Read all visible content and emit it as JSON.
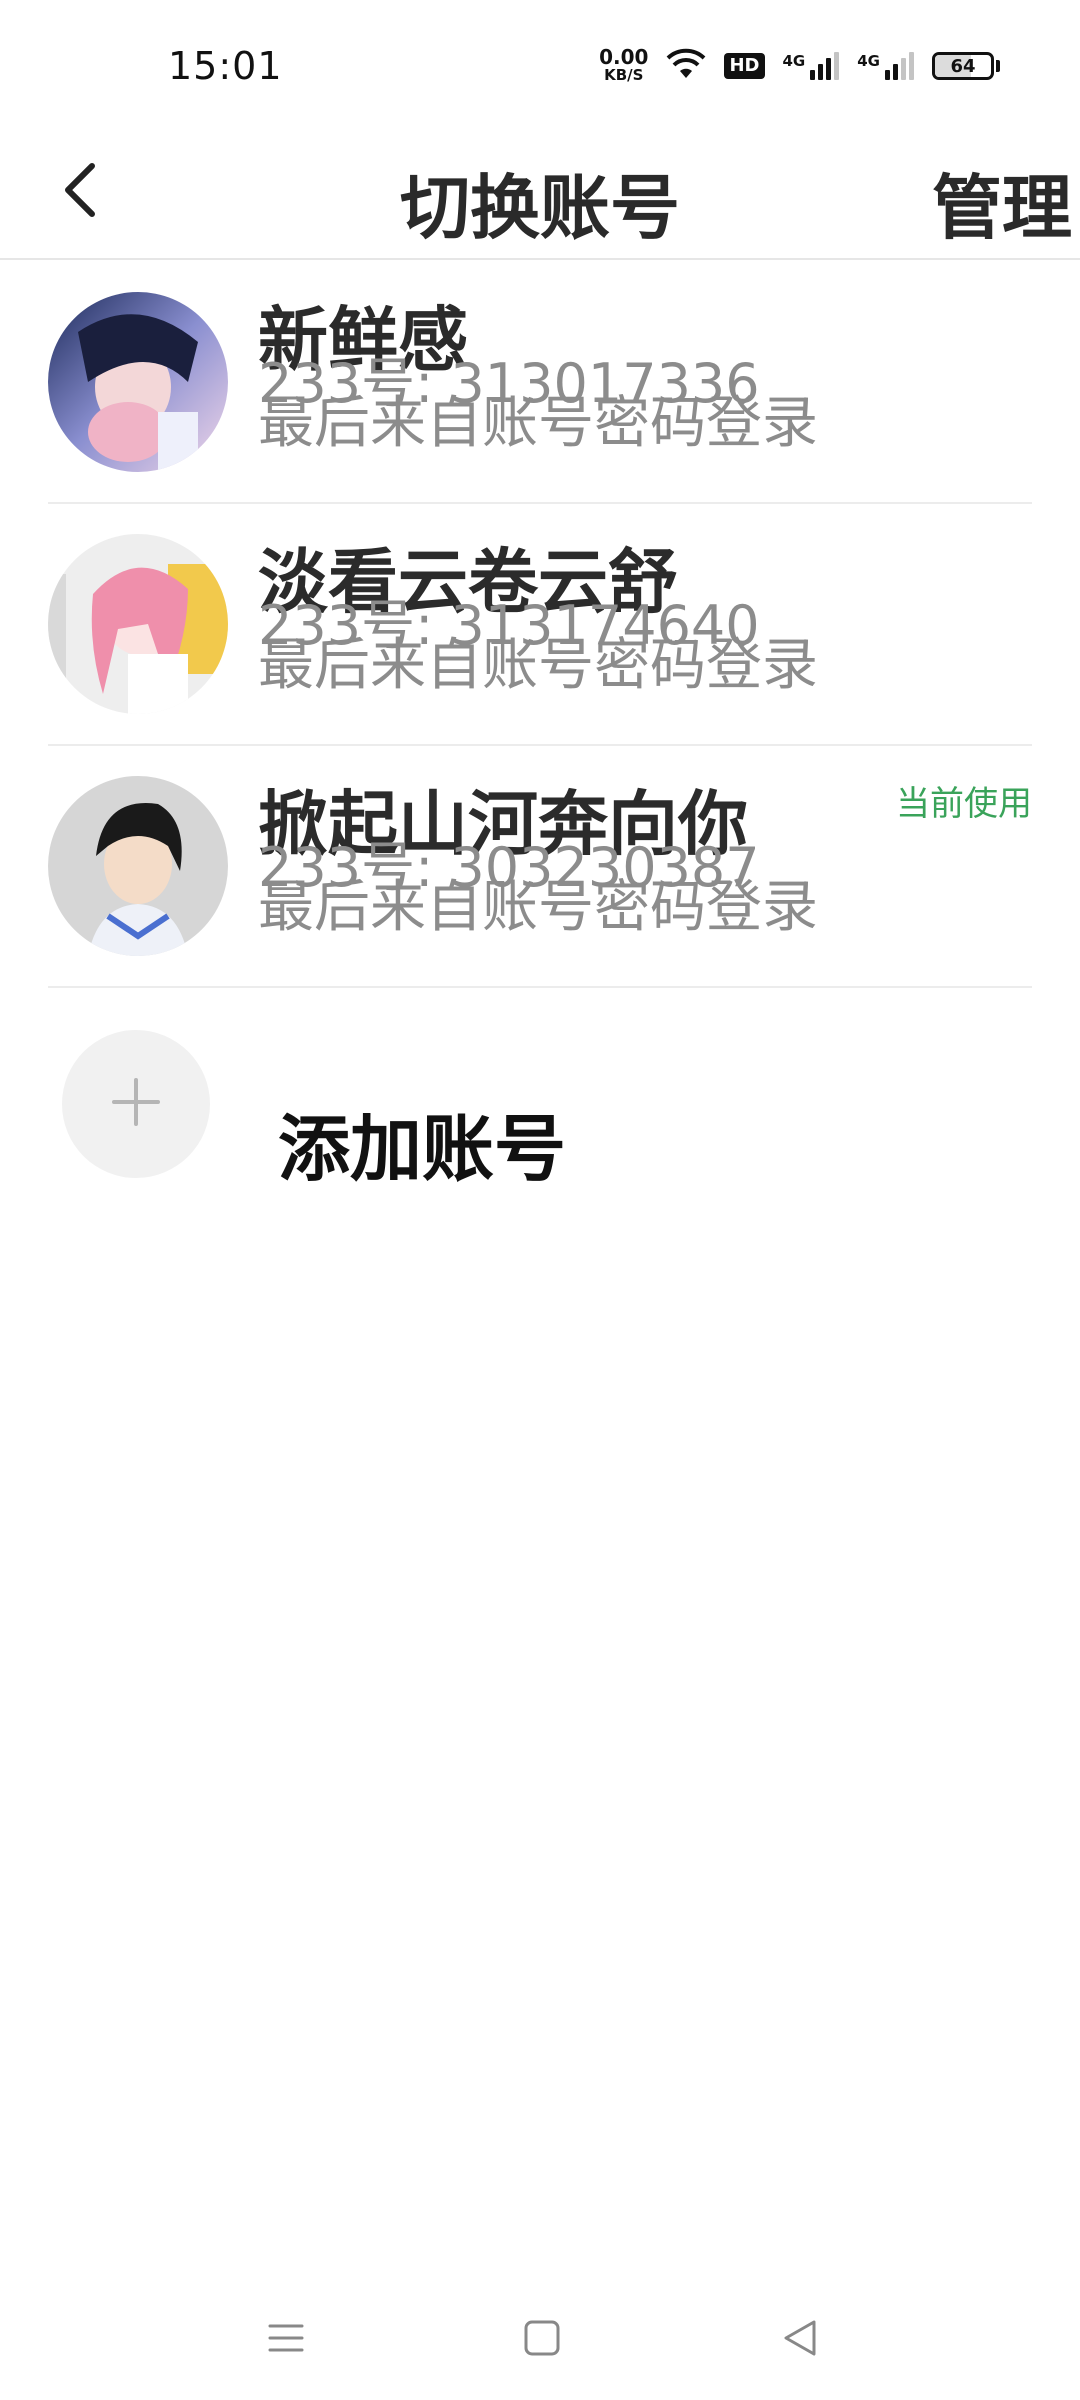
{
  "status_bar": {
    "time": "15:01",
    "net_speed_value": "0.00",
    "net_speed_unit": "KB/S",
    "hd_label": "HD",
    "signal1_label": "4G",
    "signal2_label": "4G",
    "battery_percent": "64",
    "battery_level": 0.64
  },
  "header": {
    "title": "切换账号",
    "manage_label": "管理",
    "back_icon": "chevron-left-icon"
  },
  "accounts": [
    {
      "name": "新鲜感",
      "id_text": "233号: 313017336",
      "login_text": "最后来自账号密码登录",
      "current": false
    },
    {
      "name": "淡看云卷云舒",
      "id_text": "233号: 313174640",
      "login_text": "最后来自账号密码登录",
      "current": false
    },
    {
      "name": "掀起山河奔向你",
      "id_text": "233号: 303230387",
      "login_text": "最后来自账号密码登录",
      "current": true,
      "current_label": "当前使用"
    }
  ],
  "add_account": {
    "label": "添加账号",
    "icon": "plus-icon"
  },
  "nav": {
    "menu_icon": "menu-icon",
    "home_icon": "home-square-icon",
    "back_icon": "back-triangle-icon"
  },
  "colors": {
    "accent_green": "#3aa35a",
    "secondary_text": "#8c8c8c",
    "divider": "#ececec"
  }
}
